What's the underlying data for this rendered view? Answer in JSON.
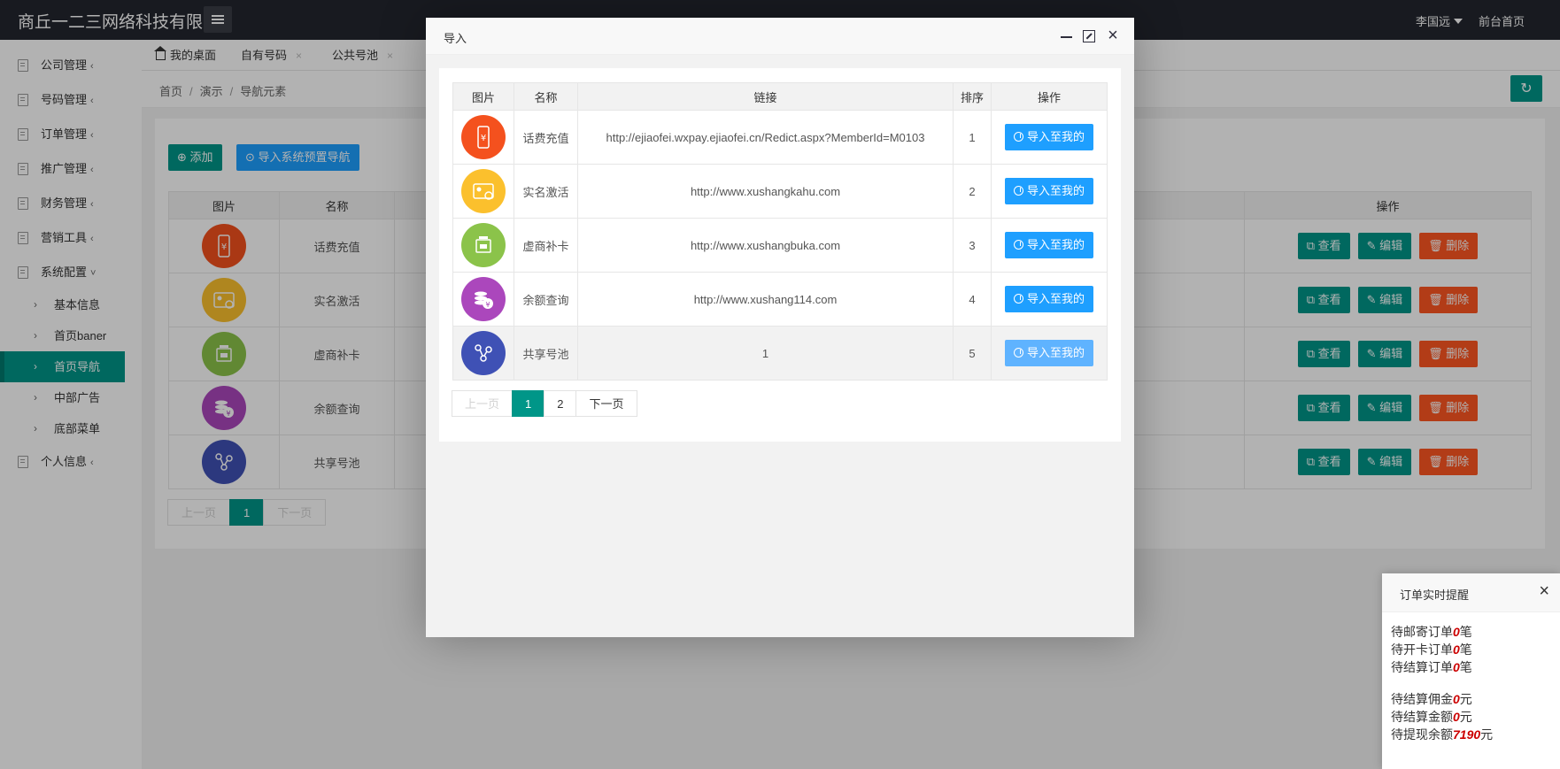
{
  "topbar": {
    "brand": "商丘一二三网络科技有限",
    "user": "李国远",
    "home": "前台首页"
  },
  "sidebar": {
    "items": [
      {
        "label": "公司管理",
        "arrow": "‹"
      },
      {
        "label": "号码管理",
        "arrow": "‹"
      },
      {
        "label": "订单管理",
        "arrow": "‹"
      },
      {
        "label": "推广管理",
        "arrow": "‹"
      },
      {
        "label": "财务管理",
        "arrow": "‹"
      },
      {
        "label": "营销工具",
        "arrow": "‹"
      },
      {
        "label": "系统配置",
        "arrow": "˅"
      }
    ],
    "subitems": [
      {
        "label": "基本信息"
      },
      {
        "label": "首页baner"
      },
      {
        "label": "首页导航"
      },
      {
        "label": "中部广告"
      },
      {
        "label": "底部菜单"
      }
    ],
    "last_item": {
      "label": "个人信息",
      "arrow": "‹"
    },
    "chevron": "›"
  },
  "tabs": [
    {
      "label": "我的桌面"
    },
    {
      "label": "自有号码",
      "close": "×"
    },
    {
      "label": "公共号池",
      "close": "×"
    }
  ],
  "breadcrumb": {
    "home": "首页",
    "sep": "/",
    "demo": "演示",
    "current": "导航元素"
  },
  "main": {
    "add_label": "添加",
    "import_sys_label": "导入系统预置导航",
    "columns": {
      "image": "图片",
      "name": "名称",
      "ops": "操作"
    },
    "rows": [
      {
        "name": "话费充值"
      },
      {
        "name": "实名激活"
      },
      {
        "name": "虚商补卡"
      },
      {
        "name": "余额查询"
      },
      {
        "name": "共享号池"
      }
    ],
    "ops": {
      "view": "查看",
      "edit": "编辑",
      "delete": "删除"
    },
    "pager": {
      "prev": "上一页",
      "page1": "1",
      "next": "下一页"
    }
  },
  "modal": {
    "title": "导入",
    "columns": {
      "image": "图片",
      "name": "名称",
      "link": "链接",
      "order": "排序",
      "ops": "操作"
    },
    "rows": [
      {
        "name": "话费充值",
        "link": "http://ejiaofei.wxpay.ejiaofei.cn/Redict.aspx?MemberId=M0103",
        "order": "1",
        "icon": "phone-recharge-icon"
      },
      {
        "name": "实名激活",
        "link": "http://www.xushangkahu.com",
        "order": "2",
        "icon": "id-card-icon"
      },
      {
        "name": "虚商补卡",
        "link": "http://www.xushangbuka.com",
        "order": "3",
        "icon": "sim-card-icon"
      },
      {
        "name": "余额查询",
        "link": "http://www.xushang114.com",
        "order": "4",
        "icon": "coins-icon"
      },
      {
        "name": "共享号池",
        "link": "1",
        "order": "5",
        "icon": "share-pool-icon"
      }
    ],
    "import_label": "导入至我的",
    "pager": {
      "prev": "上一页",
      "page1": "1",
      "page2": "2",
      "next": "下一页"
    }
  },
  "notify": {
    "title": "订单实时提醒",
    "close": "×",
    "lines": [
      {
        "prefix": "待邮寄订单",
        "value": "0",
        "suffix": "笔"
      },
      {
        "prefix": "待开卡订单",
        "value": "0",
        "suffix": "笔"
      },
      {
        "prefix": "待结算订单",
        "value": "0",
        "suffix": "笔"
      },
      {
        "prefix": "待结算佣金",
        "value": "0",
        "suffix": "元"
      },
      {
        "prefix": "待结算金额",
        "value": "0",
        "suffix": "元"
      },
      {
        "prefix": "待提现余额",
        "value": "7190",
        "suffix": "元"
      }
    ]
  },
  "colors": {
    "teal": "#009688",
    "blue": "#1e9fff",
    "red": "#ff5722",
    "topbar": "#23262e"
  }
}
